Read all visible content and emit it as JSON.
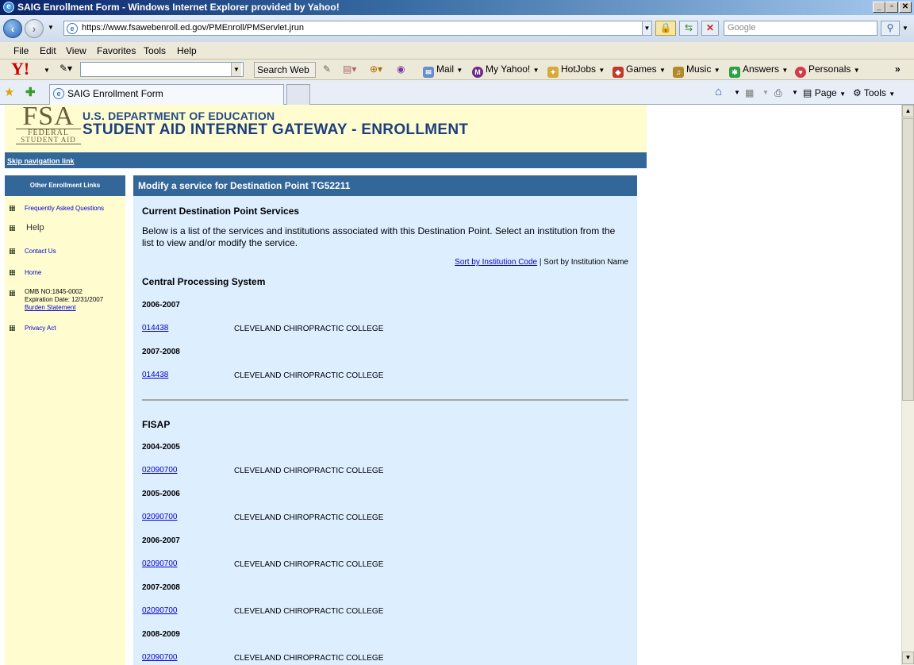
{
  "window": {
    "title": "SAIG Enrollment Form - Windows Internet Explorer provided by Yahoo!"
  },
  "address": {
    "url": "https://www.fsawebenroll.ed.gov/PMEnroll/PMServlet.jrun",
    "search_placeholder": "Google"
  },
  "menu": [
    "File",
    "Edit",
    "View",
    "Favorites",
    "Tools",
    "Help"
  ],
  "yahoo_bar": {
    "search_label": "Search Web",
    "items": [
      "Mail",
      "My Yahoo!",
      "HotJobs",
      "Games",
      "Music",
      "Answers",
      "Personals"
    ]
  },
  "tab": {
    "title": "SAIG Enrollment Form",
    "tools": [
      "Page",
      "Tools"
    ]
  },
  "header": {
    "logo_big": "FSA",
    "logo_small1": "FEDERAL",
    "logo_small2": "STUDENT AID",
    "org_line1": "U.S. DEPARTMENT OF EDUCATION",
    "org_line2": "STUDENT AID INTERNET GATEWAY - ENROLLMENT"
  },
  "skip": "Skip navigation link",
  "sidebar": {
    "heading": "Other Enrollment Links",
    "links": [
      "Frequently Asked Questions",
      "Help",
      "Contact Us",
      "Home"
    ],
    "omb_line1": "OMB NO:1845-0002",
    "omb_line2": "Expiration Date:  12/31/2007",
    "burden": "Burden Statement",
    "privacy": "Privacy Act"
  },
  "main": {
    "heading": "Modify a service for Destination Point TG52211",
    "subheading": "Current Destination Point Services",
    "description": "Below is a list of the services and institutions associated with this Destination Point. Select an institution from the list to view and/or modify the service.",
    "sort_code": "Sort by Institution Code",
    "sort_sep": " | ",
    "sort_name": "Sort by Institution Name",
    "services": [
      {
        "name": "Central Processing System",
        "years": [
          {
            "year": "2006-2007",
            "code": "014438",
            "institution": "CLEVELAND CHIROPRACTIC COLLEGE"
          },
          {
            "year": "2007-2008",
            "code": "014438",
            "institution": "CLEVELAND CHIROPRACTIC COLLEGE"
          }
        ]
      },
      {
        "name": "FISAP",
        "years": [
          {
            "year": "2004-2005",
            "code": "02090700",
            "institution": "CLEVELAND CHIROPRACTIC COLLEGE"
          },
          {
            "year": "2005-2006",
            "code": "02090700",
            "institution": "CLEVELAND CHIROPRACTIC COLLEGE"
          },
          {
            "year": "2006-2007",
            "code": "02090700",
            "institution": "CLEVELAND CHIROPRACTIC COLLEGE"
          },
          {
            "year": "2007-2008",
            "code": "02090700",
            "institution": "CLEVELAND CHIROPRACTIC COLLEGE"
          },
          {
            "year": "2008-2009",
            "code": "02090700",
            "institution": "CLEVELAND CHIROPRACTIC COLLEGE"
          }
        ]
      }
    ]
  }
}
